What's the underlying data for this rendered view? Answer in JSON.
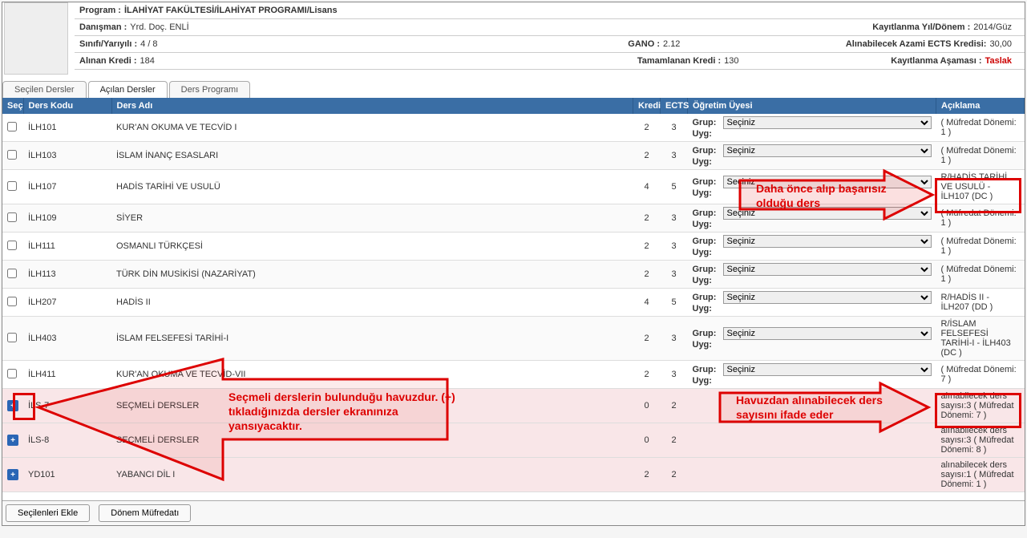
{
  "header": {
    "program_label": "Program :",
    "program_value": "İLAHİYAT FAKÜLTESİ/İLAHİYAT PROGRAMI/Lisans",
    "danisman_label": "Danışman :",
    "danisman_value": "Yrd. Doç.                           ENLİ",
    "kayit_yd_label": "Kayıtlanma Yıl/Dönem :",
    "kayit_yd_value": "2014/Güz",
    "sinif_label": "Sınıfı/Yarıyılı :",
    "sinif_value": "4 / 8",
    "gano_label": "GANO :",
    "gano_value": "2.12",
    "azami_label": "Alınabilecek Azami ECTS Kredisi:",
    "azami_value": "30,00",
    "alinan_label": "Alınan Kredi :",
    "alinan_value": "184",
    "tamamlanan_label": "Tamamlanan Kredi :",
    "tamamlanan_value": "130",
    "asama_label": "Kayıtlanma Aşaması :",
    "asama_value": "Taslak"
  },
  "tabs": {
    "t1": "Seçilen Dersler",
    "t2": "Açılan Dersler",
    "t3": "Ders Programı"
  },
  "columns": {
    "sec": "Seç",
    "kod": "Ders Kodu",
    "ad": "Ders Adı",
    "kredi": "Kredi",
    "ects": "ECTS",
    "og": "Öğretim Üyesi",
    "ac": "Açıklama"
  },
  "og": {
    "grup": "Grup:",
    "uyg": "Uyg:",
    "seciniz": "Seçiniz"
  },
  "rows": [
    {
      "kod": "İLH101",
      "ad": "KUR'AN OKUMA VE TECVİD I",
      "kredi": "2",
      "ects": "3",
      "grup": true,
      "ac": "( Müfredat Dönemi: 1 )",
      "pink": false,
      "exp": false
    },
    {
      "kod": "İLH103",
      "ad": "İSLAM İNANÇ ESASLARI",
      "kredi": "2",
      "ects": "3",
      "grup": true,
      "ac": "( Müfredat Dönemi: 1 )",
      "pink": false,
      "exp": false
    },
    {
      "kod": "İLH107",
      "ad": "HADİS TARİHİ VE USULÜ",
      "kredi": "4",
      "ects": "5",
      "grup": true,
      "ac": "R/HADİS TARİHİ VE USULÜ - İLH107 (DC )",
      "pink": false,
      "exp": false
    },
    {
      "kod": "İLH109",
      "ad": "SİYER",
      "kredi": "2",
      "ects": "3",
      "grup": true,
      "ac": "( Müfredat Dönemi: 1 )",
      "pink": false,
      "exp": false
    },
    {
      "kod": "İLH111",
      "ad": "OSMANLI TÜRKÇESİ",
      "kredi": "2",
      "ects": "3",
      "grup": true,
      "ac": "( Müfredat Dönemi: 1 )",
      "pink": false,
      "exp": false
    },
    {
      "kod": "İLH113",
      "ad": "TÜRK DİN MUSİKİSİ (NAZARİYAT)",
      "kredi": "2",
      "ects": "3",
      "grup": true,
      "ac": "( Müfredat Dönemi: 1 )",
      "pink": false,
      "exp": false
    },
    {
      "kod": "İLH207",
      "ad": "HADİS II",
      "kredi": "4",
      "ects": "5",
      "grup": true,
      "ac": "R/HADİS II - İLH207 (DD )",
      "pink": false,
      "exp": false
    },
    {
      "kod": "İLH403",
      "ad": "İSLAM FELSEFESİ TARİHİ-I",
      "kredi": "2",
      "ects": "3",
      "grup": true,
      "ac": "R/İSLAM FELSEFESİ TARİHİ-I - İLH403 (DC )",
      "pink": false,
      "exp": false
    },
    {
      "kod": "İLH411",
      "ad": "KUR'AN OKUMA VE TECVİD-VII",
      "kredi": "2",
      "ects": "3",
      "grup": true,
      "ac": "( Müfredat Dönemi: 7 )",
      "pink": false,
      "exp": false
    },
    {
      "kod": "İLS-7",
      "ad": "SEÇMELİ DERSLER",
      "kredi": "0",
      "ects": "2",
      "grup": false,
      "ac": "alınabilecek ders sayısı:3 ( Müfredat Dönemi: 7 )",
      "pink": true,
      "exp": true
    },
    {
      "kod": "İLS-8",
      "ad": "SEÇMELİ DERSLER",
      "kredi": "0",
      "ects": "2",
      "grup": false,
      "ac": "alınabilecek ders sayısı:3 ( Müfredat Dönemi: 8 )",
      "pink": true,
      "exp": true
    },
    {
      "kod": "YD101",
      "ad": "YABANCI DİL I",
      "kredi": "2",
      "ects": "2",
      "grup": false,
      "ac": "alınabilecek ders sayısı:1 ( Müfredat Dönemi: 1 )",
      "pink": true,
      "exp": true
    }
  ],
  "footer": {
    "ekle": "Seçilenleri Ekle",
    "mufredat": "Dönem Müfredatı"
  },
  "annotations": {
    "a1": "Daha önce alıp başarısız olduğu ders",
    "a2": "Seçmeli derslerin bulunduğu havuzdur. (+) tıkladığınızda dersler ekranınıza yansıyacaktır.",
    "a3": "Havuzdan alınabilecek ders sayısını ifade eder"
  }
}
